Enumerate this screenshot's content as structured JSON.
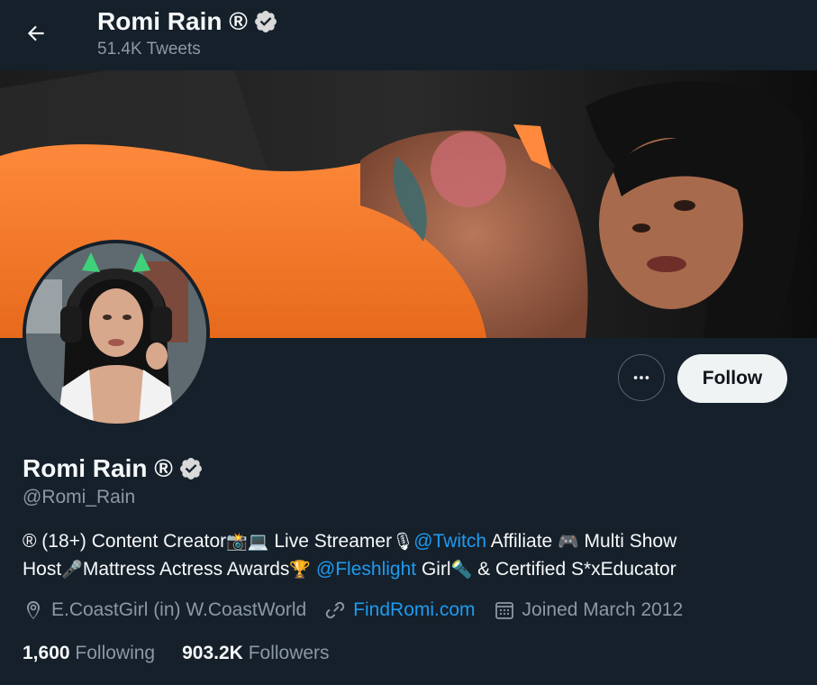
{
  "header": {
    "name": "Romi Rain ®",
    "tweet_count": "51.4K Tweets"
  },
  "profile": {
    "name": "Romi Rain ®",
    "handle": "@Romi_Rain",
    "verified": true,
    "follow_label": "Follow",
    "more_label": "•••",
    "bio": {
      "line1_a": "® (18+) Content Creator",
      "emoji_camera": "📸",
      "emoji_laptop": "💻",
      "line1_b": " Live Streamer",
      "emoji_mic": "🎙",
      "twitch_link": "@Twitch",
      "line1_c": " Affiliate ",
      "emoji_gamepad": "🎮",
      "line1_d": " Multi Show",
      "line2_a": "Host",
      "emoji_music": "🎤",
      "line2_b": "Mattress Actress Awards",
      "emoji_trophy": "🏆",
      "fleshlight_link": "@Fleshlight",
      "line2_c": " Girl",
      "emoji_flashlight": "🔦",
      "line2_d": " & Certified S*xEducator"
    },
    "location": "E.CoastGirl (in) W.CoastWorld",
    "website": "FindRomi.com",
    "joined": "Joined March 2012",
    "following_count": "1,600",
    "following_label": "Following",
    "followers_count": "903.2K",
    "followers_label": "Followers"
  },
  "colors": {
    "background": "#15202b",
    "link": "#1d9bf0",
    "secondary_text": "#8b98a5",
    "verified": "#d9d9d9"
  }
}
